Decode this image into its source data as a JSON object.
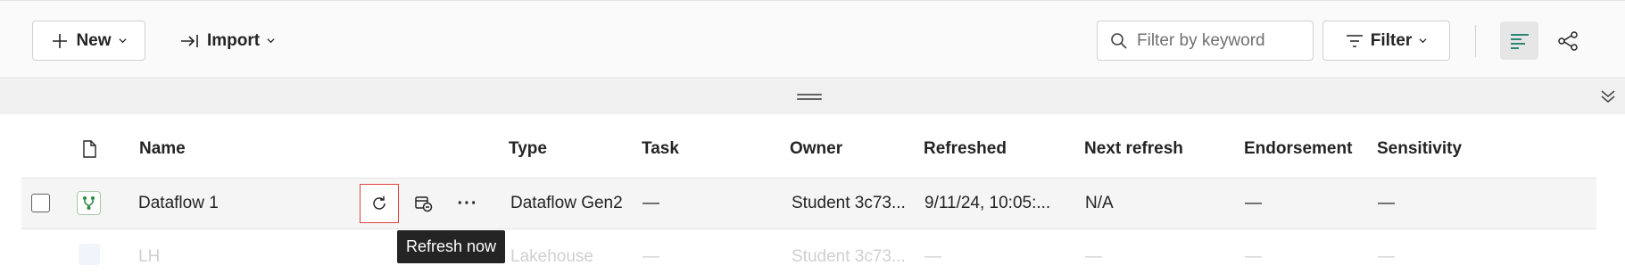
{
  "toolbar": {
    "new_label": "New",
    "import_label": "Import",
    "search_placeholder": "Filter by keyword",
    "filter_label": "Filter"
  },
  "table": {
    "columns": [
      "Name",
      "Type",
      "Task",
      "Owner",
      "Refreshed",
      "Next refresh",
      "Endorsement",
      "Sensitivity"
    ],
    "rows": [
      {
        "name": "Dataflow 1",
        "type": "Dataflow Gen2",
        "task": "—",
        "owner": "Student 3c73...",
        "refreshed": "9/11/24, 10:05:...",
        "next_refresh": "N/A",
        "endorsement": "—",
        "sensitivity": "—"
      },
      {
        "name": "LH",
        "type": "Lakehouse",
        "task": "—",
        "owner": "Student 3c73...",
        "refreshed": "—",
        "next_refresh": "—",
        "endorsement": "—",
        "sensitivity": "—"
      }
    ],
    "row_actions": {
      "more_label": "···"
    }
  },
  "tooltip": {
    "text": "Refresh now"
  },
  "colors": {
    "accent": "#117865",
    "focus_outline": "#e04040",
    "item_icon": "#2e8b3f"
  },
  "icons": [
    "plus-icon",
    "chevron-down-icon",
    "import-icon",
    "search-icon",
    "filter-icon",
    "list-view-icon",
    "lineage-view-icon",
    "drag-handle-icon",
    "collapse-icon",
    "file-icon",
    "dataflow-icon",
    "refresh-icon",
    "schedule-icon",
    "more-icon",
    "lakehouse-icon"
  ]
}
